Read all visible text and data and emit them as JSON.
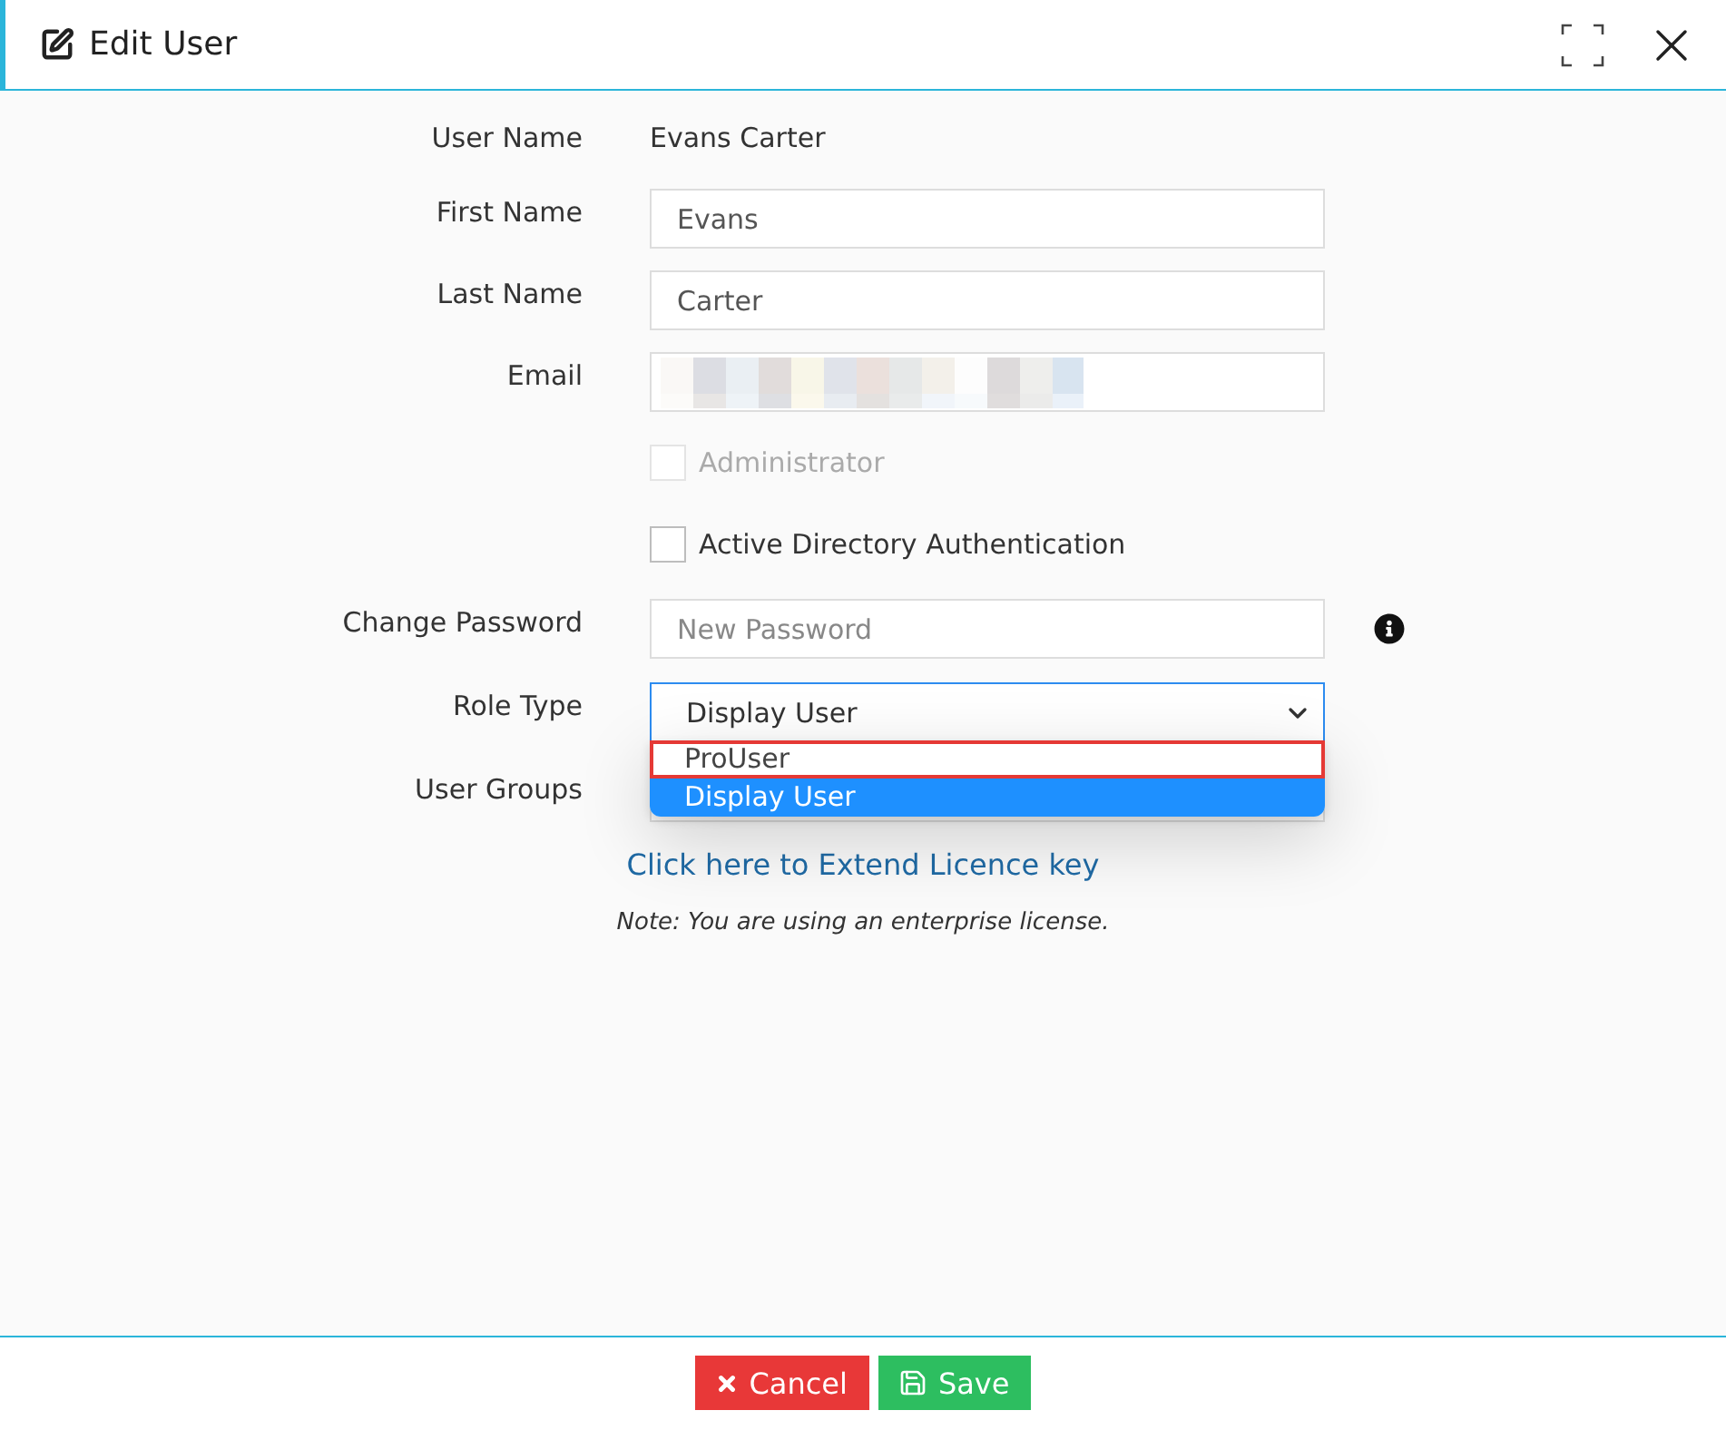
{
  "dialog": {
    "title": "Edit User"
  },
  "form": {
    "user_name": {
      "label": "User Name",
      "value": "Evans Carter"
    },
    "first_name": {
      "label": "First Name",
      "value": "Evans"
    },
    "last_name": {
      "label": "Last Name",
      "value": "Carter"
    },
    "email": {
      "label": "Email",
      "redacted": true
    },
    "checkboxes": [
      {
        "label": "Administrator",
        "checked": false,
        "disabled": true
      },
      {
        "label": "Active Directory Authentication",
        "checked": false,
        "disabled": false
      }
    ],
    "change_password": {
      "label": "Change Password",
      "placeholder": "New Password"
    },
    "role_type": {
      "label": "Role Type",
      "value": "Display User",
      "expanded": true,
      "options": [
        {
          "label": "ProUser",
          "selected": false,
          "outlined": true
        },
        {
          "label": "Display User",
          "selected": true,
          "outlined": false
        }
      ]
    },
    "user_groups": {
      "label": "User Groups"
    }
  },
  "licence_link": "Click here to Extend Licence key",
  "note": "Note: You are using an enterprise license.",
  "buttons": [
    {
      "kind": "cancel",
      "label": "Cancel"
    },
    {
      "kind": "save",
      "label": "Save"
    }
  ]
}
